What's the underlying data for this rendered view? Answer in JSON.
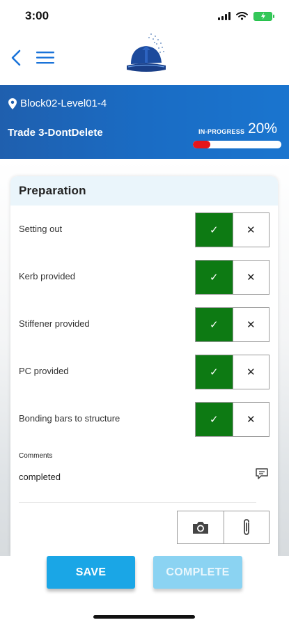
{
  "status_bar": {
    "time": "3:00"
  },
  "banner": {
    "location": "Block02-Level01-4",
    "trade": "Trade 3-DontDelete",
    "progress_label": "IN-PROGRESS",
    "progress_text": "20%",
    "progress_value": 0.2,
    "progress_color": "#e5161b"
  },
  "card": {
    "title": "Preparation",
    "items": [
      {
        "label": "Setting out",
        "state": "yes"
      },
      {
        "label": "Kerb provided",
        "state": "yes"
      },
      {
        "label": "Stiffener provided",
        "state": "yes"
      },
      {
        "label": "PC provided",
        "state": "yes"
      },
      {
        "label": "Bonding bars to structure",
        "state": "yes"
      }
    ],
    "yes_glyph": "✓",
    "no_glyph": "✕",
    "comments_label": "Comments",
    "comments_value": "completed"
  },
  "footer": {
    "save_label": "SAVE",
    "complete_label": "COMPLETE"
  },
  "colors": {
    "accent": "#1aa6e6",
    "banner": "#1f5fae",
    "yes": "#0d7a13"
  },
  "icons": [
    "back-chevron-icon",
    "menu-icon",
    "hardhat-logo",
    "location-pin-icon",
    "comment-icon",
    "camera-icon",
    "paperclip-icon",
    "wifi-icon",
    "signal-icon",
    "battery-icon"
  ]
}
